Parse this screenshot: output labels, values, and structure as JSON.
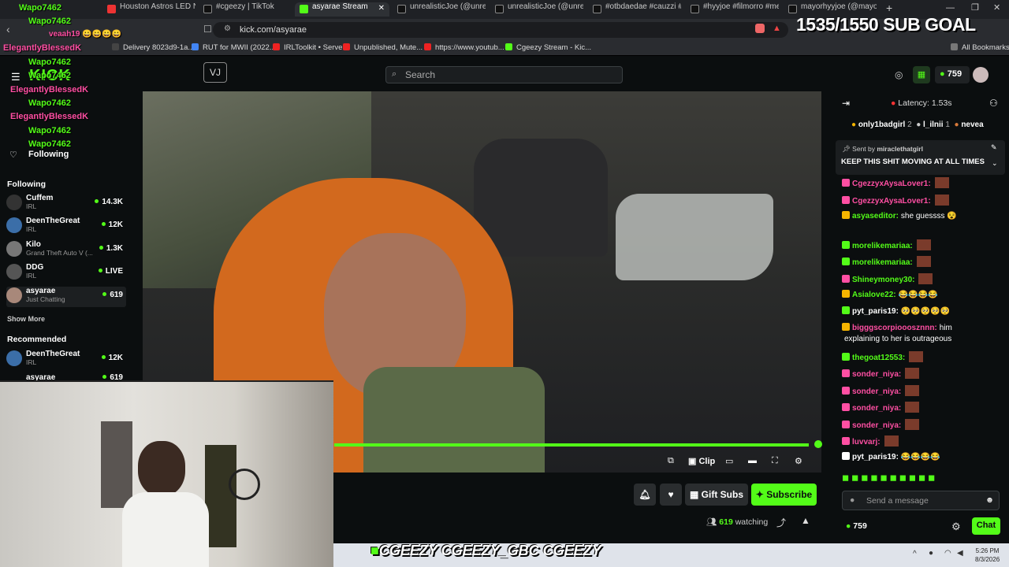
{
  "browser": {
    "tabs": [
      {
        "label": "Houston Astros LED Neo",
        "color": "#e33"
      },
      {
        "label": "#cgeezy | TikTok",
        "color": "#111"
      },
      {
        "label": "asyarae Stream",
        "color": "#53fc18"
      },
      {
        "label": "unrealisticJoe (@unrealist",
        "color": "#111"
      },
      {
        "label": "unrealisticJoe (@unrealist",
        "color": "#111"
      },
      {
        "label": "#otbdaedae #cauzzi #fyp",
        "color": "#111"
      },
      {
        "label": "#hyyjoe #filmorro #melti",
        "color": "#111"
      },
      {
        "label": "mayorhyyjoe (@mayorh",
        "color": "#111"
      }
    ],
    "url": "kick.com/asyarae",
    "bookmarks": [
      {
        "label": "Delivery 8023d9-1a...",
        "color": "#444"
      },
      {
        "label": "RUT for MWII (2022...",
        "color": "#4285f4"
      },
      {
        "label": "IRLToolkit • Server",
        "color": "#e22"
      },
      {
        "label": "Unpublished, Mute...",
        "color": "#e22"
      },
      {
        "label": "https://www.youtub...",
        "color": "#e22"
      },
      {
        "label": "Cgeezy Stream - Kic...",
        "color": "#53fc18"
      }
    ],
    "all_bookmarks": "All Bookmarks"
  },
  "overlay_chat": [
    {
      "text": "Wapo7462",
      "color": "#53fc18"
    },
    {
      "text": "Wapo7462",
      "color": "#53fc18"
    },
    {
      "text": "veaah19 😀😀😀😀",
      "color": "#ff4fa3"
    },
    {
      "text": "ElegantlyBlessedK",
      "color": "#ff4fa3"
    },
    {
      "text": "Wapo7462",
      "color": "#53fc18"
    },
    {
      "text": "Wapo7462",
      "color": "#53fc18"
    },
    {
      "text": "ElegantlyBlessedK",
      "color": "#ff4fa3"
    },
    {
      "text": "Wapo7462",
      "color": "#53fc18"
    },
    {
      "text": "ElegantlyBlessedK",
      "color": "#ff4fa3"
    },
    {
      "text": "Wapo7462",
      "color": "#53fc18"
    },
    {
      "text": "Wapo7462",
      "color": "#53fc18"
    }
  ],
  "sub_goal": "1535/1550 SUB GOAL",
  "header": {
    "search_placeholder": "Search",
    "balance": "759"
  },
  "sidebar": {
    "following_title": "Following",
    "following_label": "Following",
    "following": [
      {
        "name": "Cuffem",
        "category": "IRL",
        "viewers": "14.3K"
      },
      {
        "name": "DeenTheGreat",
        "category": "IRL",
        "viewers": "12K"
      },
      {
        "name": "Kilo",
        "category": "Grand Theft Auto V (...",
        "viewers": "1.3K"
      },
      {
        "name": "DDG",
        "category": "IRL",
        "viewers": "LIVE"
      },
      {
        "name": "asyarae",
        "category": "Just Chatting",
        "viewers": "619"
      }
    ],
    "show_more": "Show More",
    "recommended_title": "Recommended",
    "recommended": [
      {
        "name": "DeenTheGreat",
        "category": "IRL",
        "viewers": "12K"
      },
      {
        "name": "asyarae",
        "category": "",
        "viewers": "619"
      }
    ]
  },
  "player": {
    "clip": "Clip",
    "progress": 0.98
  },
  "actions": {
    "gift_subs": "Gift Subs",
    "subscribe": "Subscribe",
    "watching_count": "619",
    "watching_label": "watching"
  },
  "chat": {
    "latency": "Latency: 1.53s",
    "top_gifters": [
      {
        "name": "only1badgirl",
        "count": "2"
      },
      {
        "name": "l_ilnii",
        "count": "1"
      },
      {
        "name": "nevea",
        "count": ""
      }
    ],
    "pinned_by_label": "Sent by",
    "pinned_by": "miraclethatgirl",
    "pinned_message": "KEEP THIS SHIT MOVING AT ALL TIMES",
    "messages": [
      {
        "user": "CgezzyxAysaLover1:",
        "color": "#ff4fa3",
        "text": "",
        "emote": true
      },
      {
        "user": "CgezzyxAysaLover1:",
        "color": "#ff4fa3",
        "text": "",
        "emote": true
      },
      {
        "user": "asyaseditor:",
        "color": "#53fc18",
        "text": "she guessss 😵",
        "emote": false
      },
      {
        "user": "morelikemariaa:",
        "color": "#53fc18",
        "text": "",
        "emote": true
      },
      {
        "user": "morelikemariaa:",
        "color": "#53fc18",
        "text": "",
        "emote": true
      },
      {
        "user": "Shineymoney30:",
        "color": "#53fc18",
        "text": "",
        "emote": true
      },
      {
        "user": "Asialove22:",
        "color": "#53fc18",
        "text": "😂😂😂😂",
        "emote": false
      },
      {
        "user": "pyt_paris19:",
        "color": "#ffffff",
        "text": "🥺🥺🥺🥺🥺",
        "emote": false
      },
      {
        "user": "bigggscorpiooosznnn:",
        "color": "#ff4fa3",
        "text": "him",
        "emote": false
      },
      {
        "user": "",
        "color": "#ffffff",
        "text": "explaining to her is outrageous",
        "emote": false
      },
      {
        "user": "thegoat12553:",
        "color": "#53fc18",
        "text": "",
        "emote": true
      },
      {
        "user": "sonder_niya:",
        "color": "#ff4fa3",
        "text": "",
        "emote": true
      },
      {
        "user": "sonder_niya:",
        "color": "#ff4fa3",
        "text": "",
        "emote": true
      },
      {
        "user": "sonder_niya:",
        "color": "#ff4fa3",
        "text": "",
        "emote": true
      },
      {
        "user": "sonder_niya:",
        "color": "#ff4fa3",
        "text": "",
        "emote": true
      },
      {
        "user": "luvvarj:",
        "color": "#ff4fa3",
        "text": "",
        "emote": true
      },
      {
        "user": "pyt_paris19:",
        "color": "#ffffff",
        "text": "😂😂😂😂",
        "emote": false
      }
    ],
    "input_placeholder": "Send a message",
    "balance": "759",
    "chat_button": "Chat"
  },
  "socials": "CGEEZY  CGEEZY_GBC  CGEEZY",
  "taskbar": {
    "time": "5:26 PM",
    "date": "8/3/2026"
  }
}
